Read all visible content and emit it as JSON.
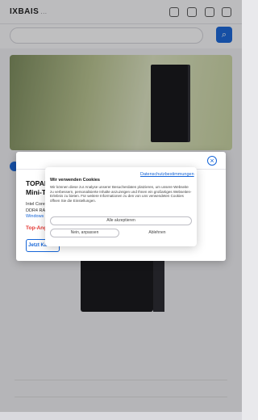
{
  "header": {
    "logo_text": "IXBAIS",
    "logo_suffix": "...",
    "search_placeholder": "",
    "search_button": "⌕"
  },
  "banner": {
    "title": ""
  },
  "background_product": {
    "brand": "",
    "name": "",
    "description": "",
    "rating_label": "",
    "tabs": ""
  },
  "product_modal": {
    "close_icon": "×",
    "title_line1": "TOPANG",
    "title_line2": "Mini-To",
    "spec_cpu": "Intel Core i",
    "spec_ram": "DDR4 RAM",
    "spec_os": "Windows 1",
    "offer": "Top-Ange",
    "buy_button": "Jetzt Kaufen"
  },
  "cookie_dialog": {
    "privacy_link": "Datenschutzbestimmungen",
    "title": "Wir verwenden Cookies",
    "body": "Wir können diese zur Analyse unserer Besucherdaten platzieren, um unsere Webseite zu verbessern, personalisierte Inhalte anzuzeigen und Ihnen ein großartiges Webseiten-Erlebnis zu bieten. Für weitere Informationen zu den von uns verwendeten Cookies öffnen Sie die Einstellungen.",
    "accept_all": "Alle akzeptieren",
    "adjust": "Nein, anpassen",
    "reject": "Ablehnen"
  },
  "colors": {
    "accent": "#1565d8",
    "offer": "#e53935"
  }
}
